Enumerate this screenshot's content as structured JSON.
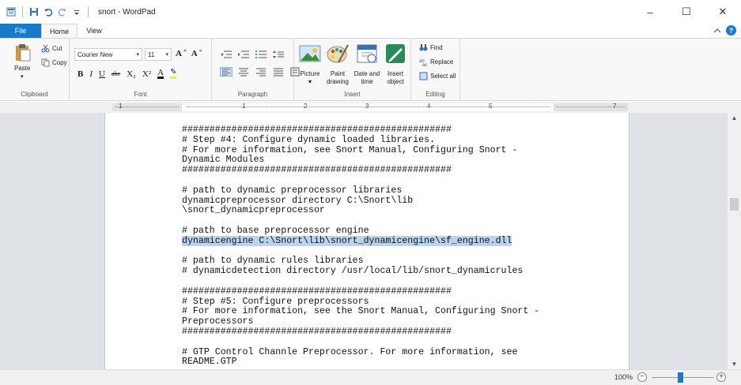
{
  "window": {
    "title": "snort - WordPad",
    "title_sep": "|",
    "controls": {
      "minimize": "–",
      "maximize": "☐",
      "close": "✕"
    }
  },
  "quick_access": {
    "icons": [
      "wordpad-icon",
      "save-icon",
      "undo-icon",
      "redo-icon",
      "customize-qat-icon"
    ]
  },
  "tabs": {
    "file": "File",
    "home": "Home",
    "view": "View"
  },
  "ribbon": {
    "clipboard": {
      "label": "Clipboard",
      "paste": "Paste",
      "cut": "Cut",
      "copy": "Copy"
    },
    "font": {
      "label": "Font",
      "family": "Courier New",
      "size": "11",
      "grow_shrink": "Aˆ Aˇ",
      "bold": "B",
      "italic": "I",
      "underline": "U",
      "strike": "abc",
      "subscript": "X₂",
      "superscript": "X²",
      "color": "A",
      "highlight": "✎"
    },
    "paragraph": {
      "label": "Paragraph"
    },
    "insert": {
      "label": "Insert",
      "picture": "Picture",
      "paint_1": "Paint",
      "paint_2": "drawing",
      "datetime_1": "Date and",
      "datetime_2": "time",
      "object_1": "Insert",
      "object_2": "object"
    },
    "editing": {
      "label": "Editing",
      "find": "Find",
      "replace": "Replace",
      "select_all": "Select all"
    }
  },
  "ruler": {
    "numbers": [
      "1",
      "1",
      "2",
      "3",
      "4",
      "5",
      "7"
    ]
  },
  "document": {
    "lines": [
      "#################################################",
      "# Step #4: Configure dynamic loaded libraries.",
      "# For more information, see Snort Manual, Configuring Snort -",
      "Dynamic Modules",
      "#################################################",
      "",
      "# path to dynamic preprocessor libraries",
      "dynamicpreprocessor directory C:\\Snort\\lib",
      "\\snort_dynamicpreprocessor",
      "",
      "# path to base preprocessor engine",
      "dynamicengine C:\\Snort\\lib\\snort_dynamicengine\\sf_engine.dll",
      "",
      "# path to dynamic rules libraries",
      "# dynamicdetection directory /usr/local/lib/snort_dynamicrules",
      "",
      "#################################################",
      "# Step #5: Configure preprocessors",
      "# For more information, see the Snort Manual, Configuring Snort -",
      "Preprocessors",
      "#################################################",
      "",
      "# GTP Control Channle Preprocessor. For more information, see",
      "README.GTP"
    ],
    "selected_line": "dynamicengine C:\\Snort\\lib\\snort_dynamicengine\\sf_engine.dll"
  },
  "status": {
    "zoom": "100%",
    "zoom_level_percent": 100,
    "zoom_minus": "−",
    "zoom_plus": "+"
  },
  "colors": {
    "accent": "#1979ca",
    "selection": "#b9d4ee",
    "workspace": "#dfe3e8"
  }
}
